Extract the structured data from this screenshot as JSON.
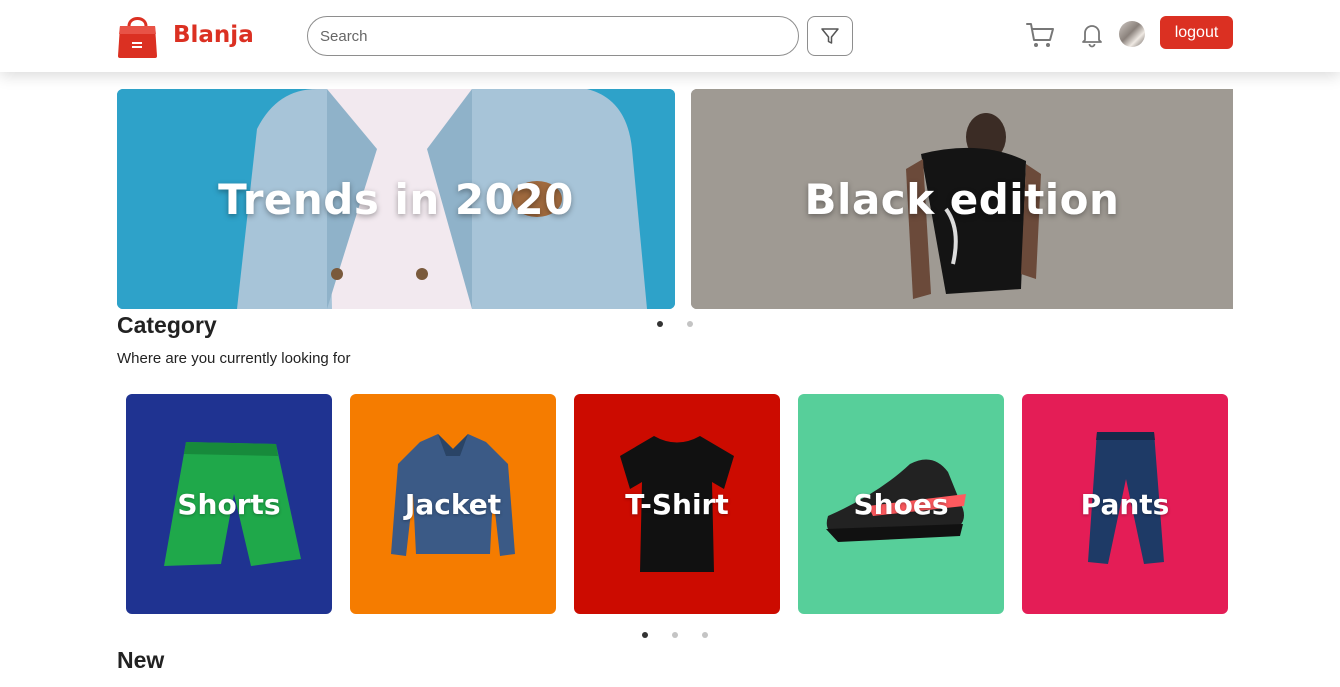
{
  "header": {
    "brand_name": "Blanja",
    "search_placeholder": "Search",
    "logout_label": "logout",
    "icons": [
      "bag-logo-icon",
      "filter-icon",
      "cart-icon",
      "bell-icon"
    ]
  },
  "banners": [
    {
      "title": "Trends in 2020",
      "color": "#2ea2c9"
    },
    {
      "title": "Black edition",
      "color": "#9a948e"
    }
  ],
  "banner_carousel": {
    "pages": 2,
    "active": 0
  },
  "category": {
    "title": "Category",
    "subtitle": "Where are you currently looking for",
    "items": [
      {
        "label": "Shorts",
        "color": "#1f3391",
        "icon": "shorts-image"
      },
      {
        "label": "Jacket",
        "color": "#f57c00",
        "icon": "jacket-image"
      },
      {
        "label": "T-Shirt",
        "color": "#cc0b00",
        "icon": "tshirt-image"
      },
      {
        "label": "Shoes",
        "color": "#57cf9a",
        "icon": "shoes-image"
      },
      {
        "label": "Pants",
        "color": "#e41d56",
        "icon": "pants-image"
      }
    ],
    "carousel": {
      "pages": 3,
      "active": 0
    }
  },
  "new_section": {
    "title": "New"
  },
  "colors": {
    "brand": "#DB3022"
  }
}
